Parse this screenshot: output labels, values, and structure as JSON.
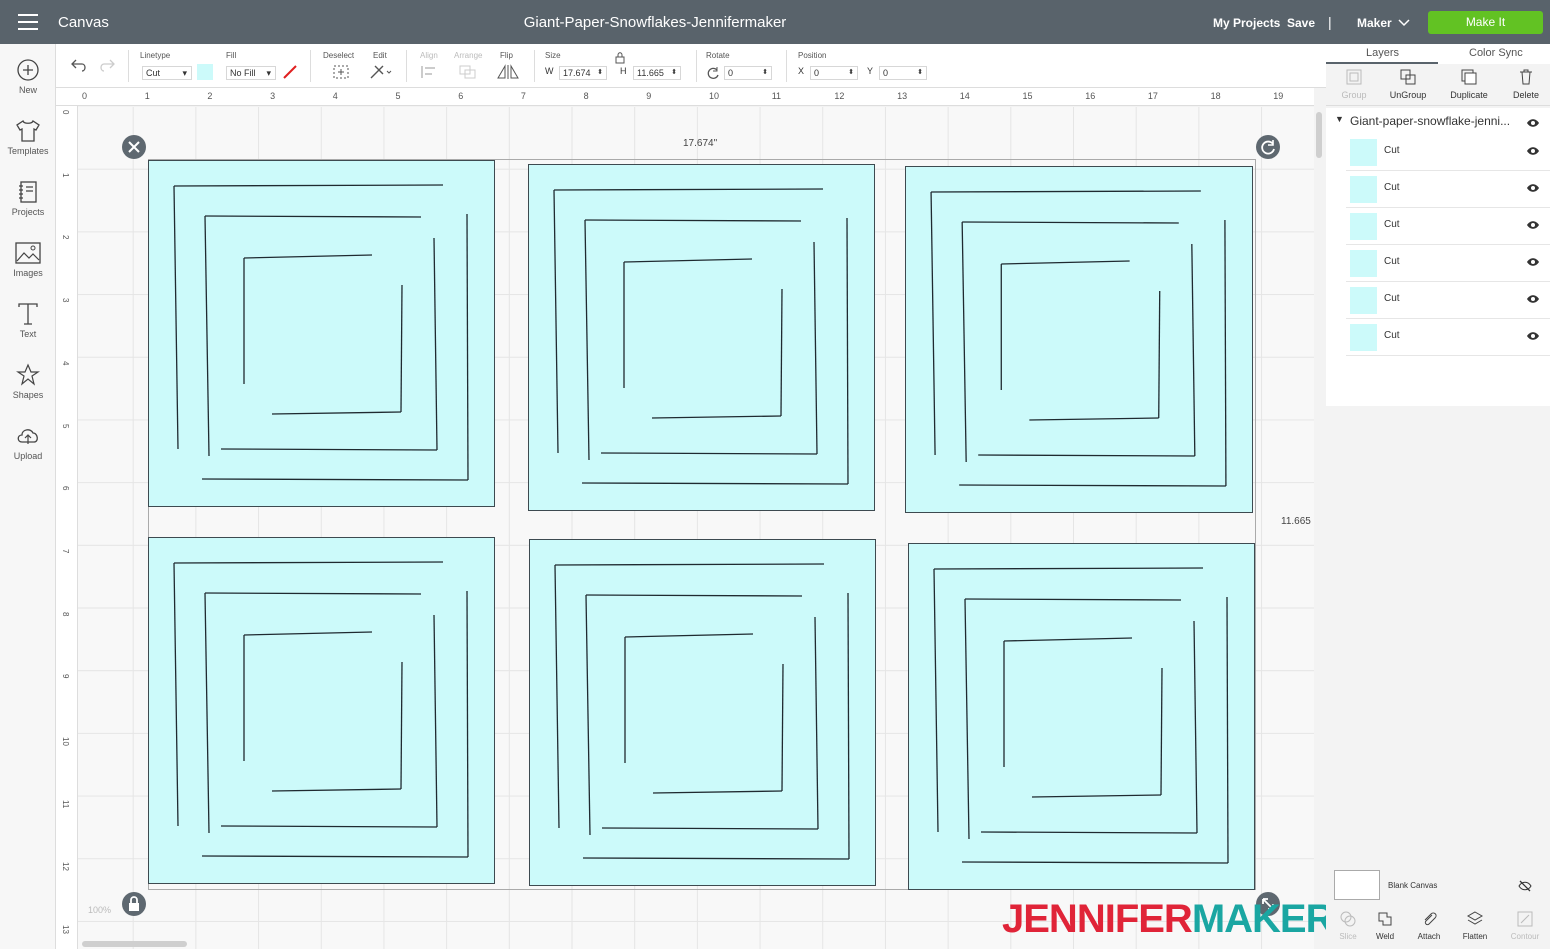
{
  "header": {
    "app_title": "Canvas",
    "project_title": "Giant-Paper-Snowflakes-Jennifermaker",
    "my_projects": "My Projects",
    "save": "Save",
    "separator": "|",
    "machine": "Maker",
    "make_it": "Make It"
  },
  "sidebar": {
    "items": [
      {
        "label": "New",
        "icon": "plus-circle-icon"
      },
      {
        "label": "Templates",
        "icon": "tshirt-icon"
      },
      {
        "label": "Projects",
        "icon": "notebook-icon"
      },
      {
        "label": "Images",
        "icon": "image-icon"
      },
      {
        "label": "Text",
        "icon": "text-icon"
      },
      {
        "label": "Shapes",
        "icon": "shapes-icon"
      },
      {
        "label": "Upload",
        "icon": "cloud-upload-icon"
      }
    ]
  },
  "toolbar": {
    "linetype_label": "Linetype",
    "linetype_value": "Cut",
    "fill_label": "Fill",
    "fill_value": "No Fill",
    "deselect_label": "Deselect",
    "edit_label": "Edit",
    "align_label": "Align",
    "arrange_label": "Arrange",
    "flip_label": "Flip",
    "size_label": "Size",
    "w_label": "W",
    "w_value": "17.674",
    "h_label": "H",
    "h_value": "11.665",
    "rotate_label": "Rotate",
    "rotate_value": "0",
    "position_label": "Position",
    "x_label": "X",
    "x_value": "0",
    "y_label": "Y",
    "y_value": "0",
    "swatch_color": "#ccfafa"
  },
  "ruler": {
    "top": [
      "0",
      "1",
      "2",
      "3",
      "4",
      "5",
      "6",
      "7",
      "8",
      "9",
      "10",
      "11",
      "12",
      "13",
      "14",
      "15",
      "16",
      "17",
      "18",
      "19"
    ],
    "left": [
      "0",
      "1",
      "2",
      "3",
      "4",
      "5",
      "6",
      "7",
      "8",
      "9",
      "10",
      "11",
      "12",
      "13"
    ]
  },
  "canvas": {
    "width_label": "17.674\"",
    "height_label": "11.665",
    "zoom": "100%",
    "tile_color": "#ccfafa",
    "cut_line_color": "#1f2a30"
  },
  "watermark": {
    "part1": "JENNIFER",
    "part2": "MAKER"
  },
  "panel": {
    "tabs": [
      "Layers",
      "Color Sync"
    ],
    "tools": [
      {
        "label": "Group",
        "enabled": false
      },
      {
        "label": "UnGroup",
        "enabled": true
      },
      {
        "label": "Duplicate",
        "enabled": true
      },
      {
        "label": "Delete",
        "enabled": true
      }
    ],
    "group_name": "Giant-paper-snowflake-jenni...",
    "layers": [
      {
        "name": "Cut"
      },
      {
        "name": "Cut"
      },
      {
        "name": "Cut"
      },
      {
        "name": "Cut"
      },
      {
        "name": "Cut"
      },
      {
        "name": "Cut"
      }
    ],
    "blank_canvas": "Blank Canvas",
    "bottom_tools": [
      {
        "label": "Slice",
        "enabled": false
      },
      {
        "label": "Weld",
        "enabled": true
      },
      {
        "label": "Attach",
        "enabled": true
      },
      {
        "label": "Flatten",
        "enabled": true
      },
      {
        "label": "Contour",
        "enabled": false
      }
    ]
  }
}
